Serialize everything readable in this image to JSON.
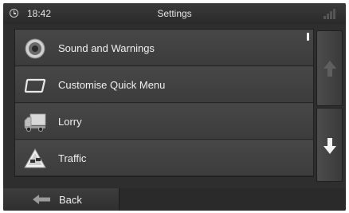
{
  "status_bar": {
    "time": "18:42",
    "title": "Settings",
    "clock_icon": "clock-icon",
    "signal_icon": "signal-strength-icon"
  },
  "menu": {
    "items": [
      {
        "label": "Sound and Warnings",
        "icon": "speaker-icon"
      },
      {
        "label": "Customise Quick Menu",
        "icon": "quick-menu-icon"
      },
      {
        "label": "Lorry",
        "icon": "lorry-icon"
      },
      {
        "label": "Traffic",
        "icon": "traffic-warning-icon"
      }
    ]
  },
  "scroll": {
    "up_icon": "arrow-up-icon",
    "down_icon": "arrow-down-icon"
  },
  "footer": {
    "back_label": "Back",
    "back_icon": "back-arrow-icon"
  }
}
